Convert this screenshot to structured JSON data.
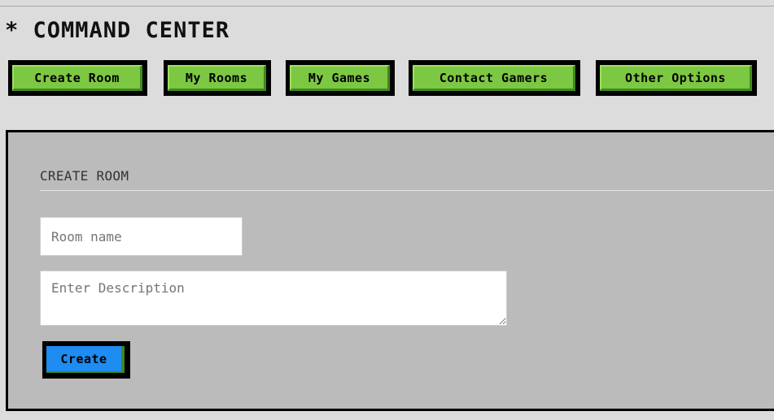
{
  "header": {
    "title": "* COMMAND CENTER"
  },
  "nav": {
    "items": [
      {
        "label": "Create Room"
      },
      {
        "label": "My Rooms"
      },
      {
        "label": "My Games"
      },
      {
        "label": "Contact Gamers"
      },
      {
        "label": "Other Options"
      }
    ]
  },
  "create_room": {
    "section_title": "CREATE ROOM",
    "room_name_placeholder": "Room name",
    "description_placeholder": "Enter Description",
    "submit_label": "Create"
  },
  "colors": {
    "page_background": "#dcdcdc",
    "panel_background": "#bbbbbb",
    "nav_button": "#7dc842",
    "nav_button_shadow": "#3f8a1f",
    "primary_button": "#1e8cf0"
  }
}
